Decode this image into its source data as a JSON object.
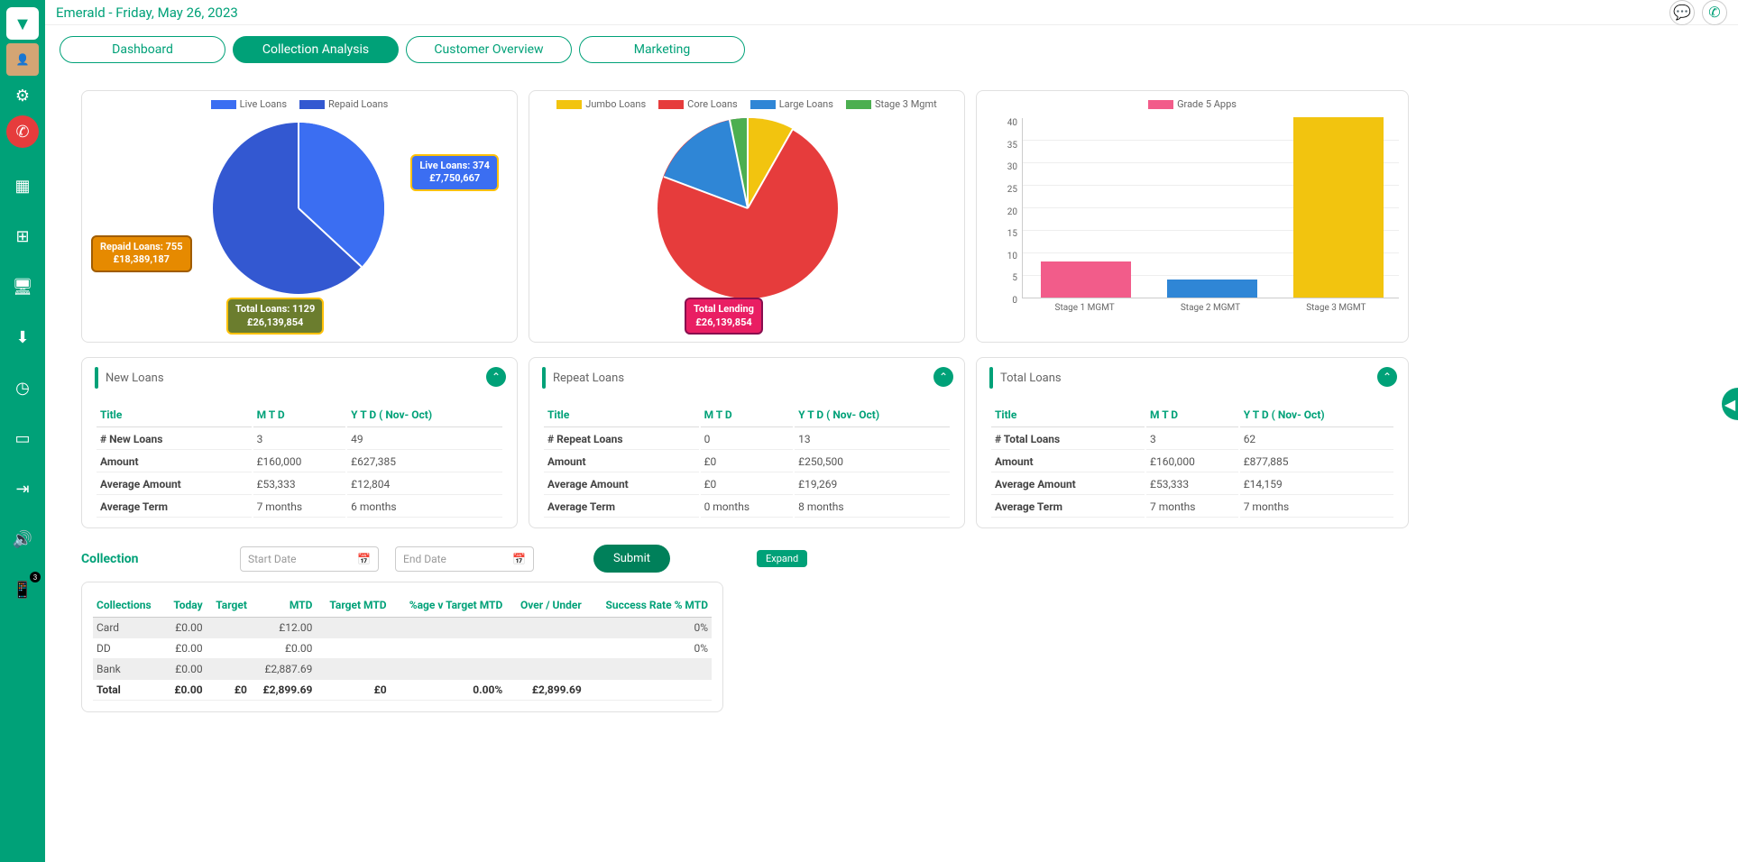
{
  "header": {
    "title": "Emerald - Friday, May 26, 2023"
  },
  "tabs": [
    "Dashboard",
    "Collection Analysis",
    "Customer Overview",
    "Marketing"
  ],
  "sidebar": {
    "notif_count": "3"
  },
  "chart1": {
    "legend": [
      {
        "c": "#3b6ef2",
        "t": "Live Loans"
      },
      {
        "c": "#3358d1",
        "t": "Repaid Loans"
      }
    ],
    "callout_live_1": "Live Loans: 374",
    "callout_live_2": "£7,750,667",
    "callout_repaid_1": "Repaid Loans: 755",
    "callout_repaid_2": "£18,389,187",
    "callout_total_1": "Total Loans: 1129",
    "callout_total_2": "£26,139,854"
  },
  "chart2": {
    "legend": [
      {
        "c": "#f2c40f",
        "t": "Jumbo Loans"
      },
      {
        "c": "#e63c3c",
        "t": "Core Loans"
      },
      {
        "c": "#2f86d6",
        "t": "Large Loans"
      },
      {
        "c": "#4caf50",
        "t": "Stage 3 Mgmt"
      }
    ],
    "callout_1": "Total Lending",
    "callout_2": "£26,139,854"
  },
  "chart3": {
    "legend": {
      "c": "#f25c8a",
      "t": "Grade 5 Apps"
    },
    "yticks": [
      "40",
      "35",
      "30",
      "25",
      "20",
      "15",
      "10",
      "5",
      "0"
    ],
    "xlabels": [
      "Stage 1 MGMT",
      "Stage 2 MGMT",
      "Stage 3 MGMT"
    ]
  },
  "chart_data": [
    {
      "type": "pie",
      "title": "Loans",
      "series": [
        {
          "name": "Live Loans",
          "count": 374,
          "amount": 7750667
        },
        {
          "name": "Repaid Loans",
          "count": 755,
          "amount": 18389187
        }
      ],
      "total": {
        "count": 1129,
        "amount": 26139854
      }
    },
    {
      "type": "pie",
      "title": "Lending",
      "series": [
        {
          "name": "Jumbo Loans",
          "pct": 8
        },
        {
          "name": "Core Loans",
          "pct": 72
        },
        {
          "name": "Large Loans",
          "pct": 17
        },
        {
          "name": "Stage 3 Mgmt",
          "pct": 3
        }
      ],
      "total_amount": 26139854
    },
    {
      "type": "bar",
      "title": "Grade 5 Apps",
      "categories": [
        "Stage 1 MGMT",
        "Stage 2 MGMT",
        "Stage 3 MGMT"
      ],
      "values": [
        8,
        4,
        40
      ],
      "ylim": [
        0,
        40
      ]
    }
  ],
  "new_loans": {
    "title": "New Loans",
    "cols": [
      "Title",
      "M T D",
      "Y T D ( Nov- Oct)"
    ],
    "rows": [
      [
        "# New Loans",
        "3",
        "49"
      ],
      [
        "Amount",
        "£160,000",
        "£627,385"
      ],
      [
        "Average Amount",
        "£53,333",
        "£12,804"
      ],
      [
        "Average Term",
        "7 months",
        "6 months"
      ]
    ]
  },
  "repeat_loans": {
    "title": "Repeat Loans",
    "cols": [
      "Title",
      "M T D",
      "Y T D ( Nov- Oct)"
    ],
    "rows": [
      [
        "# Repeat Loans",
        "0",
        "13"
      ],
      [
        "Amount",
        "£0",
        "£250,500"
      ],
      [
        "Average Amount",
        "£0",
        "£19,269"
      ],
      [
        "Average Term",
        "0 months",
        "8 months"
      ]
    ]
  },
  "total_loans": {
    "title": "Total Loans",
    "cols": [
      "Title",
      "M T D",
      "Y T D ( Nov- Oct)"
    ],
    "rows": [
      [
        "# Total Loans",
        "3",
        "62"
      ],
      [
        "Amount",
        "£160,000",
        "£877,885"
      ],
      [
        "Average Amount",
        "£53,333",
        "£14,159"
      ],
      [
        "Average Term",
        "7 months",
        "7 months"
      ]
    ]
  },
  "collection": {
    "title": "Collection",
    "start_ph": "Start Date",
    "end_ph": "End Date",
    "submit": "Submit",
    "expand": "Expand",
    "headers": [
      "Collections",
      "Today",
      "Target",
      "MTD",
      "Target MTD",
      "%age v Target MTD",
      "Over / Under",
      "Success Rate % MTD"
    ],
    "rows": [
      {
        "cells": [
          "Card",
          "£0.00",
          "",
          "£12.00",
          "",
          "",
          "",
          "0%"
        ],
        "shade": true
      },
      {
        "cells": [
          "DD",
          "£0.00",
          "",
          "£0.00",
          "",
          "",
          "",
          "0%"
        ],
        "shade": false
      },
      {
        "cells": [
          "Bank",
          "£0.00",
          "",
          "£2,887.69",
          "",
          "",
          "",
          ""
        ],
        "shade": true
      },
      {
        "cells": [
          "Total",
          "£0.00",
          "£0",
          "£2,899.69",
          "£0",
          "0.00%",
          "£2,899.69",
          ""
        ],
        "shade": false,
        "total": true
      }
    ]
  }
}
